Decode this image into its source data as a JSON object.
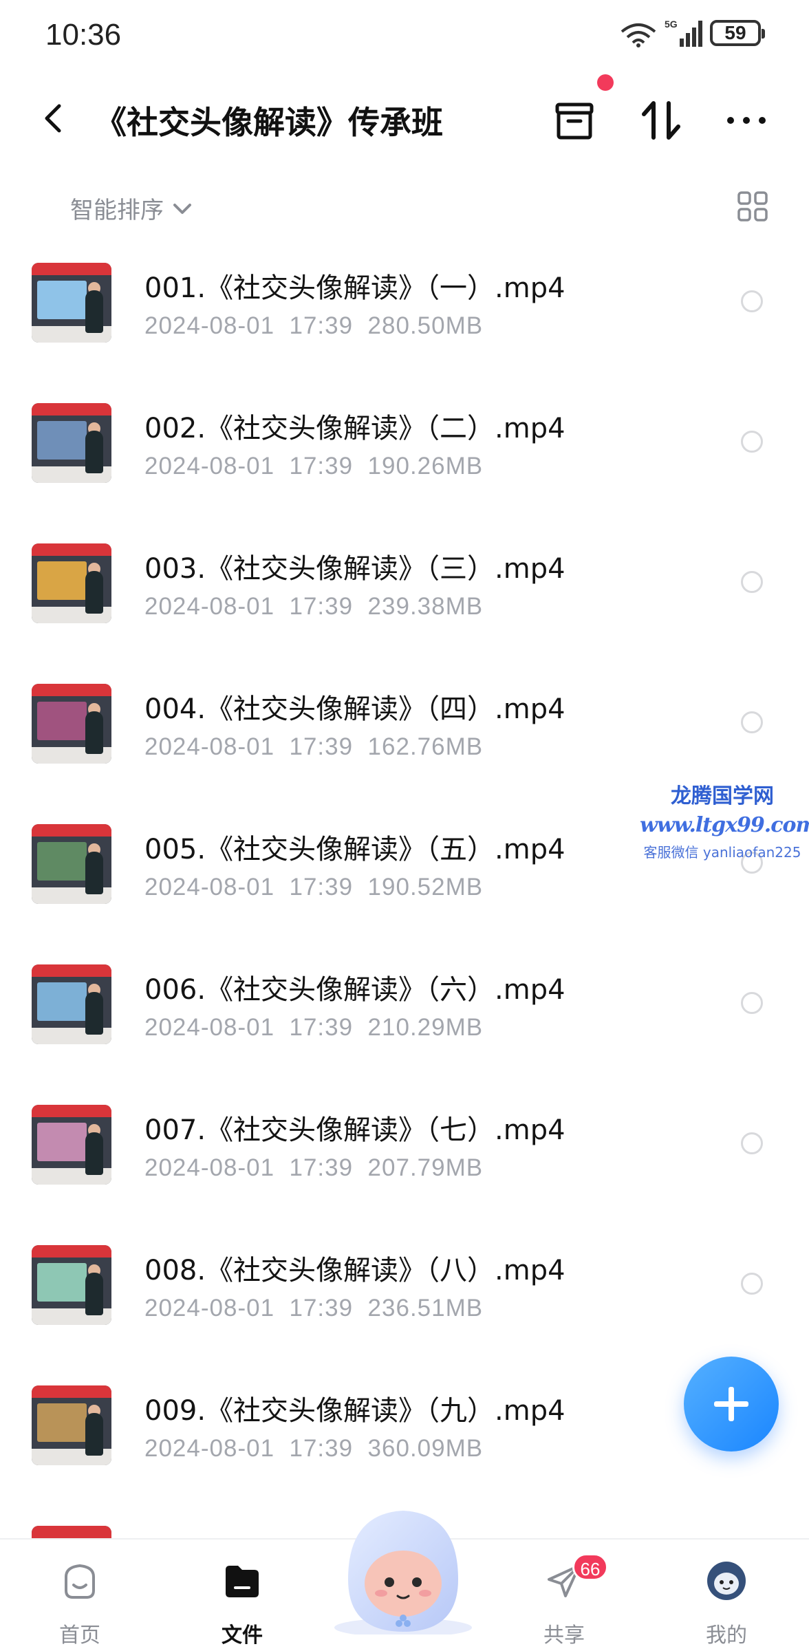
{
  "status_bar": {
    "time": "10:36",
    "network": "5G",
    "battery": "59"
  },
  "header": {
    "title": "《社交头像解读》传承班"
  },
  "sort": {
    "label": "智能排序"
  },
  "files": [
    {
      "name": "001.《社交头像解读》（一）.mp4",
      "date": "2024-08-01",
      "time": "17:39",
      "size": "280.50MB"
    },
    {
      "name": "002.《社交头像解读》（二）.mp4",
      "date": "2024-08-01",
      "time": "17:39",
      "size": "190.26MB"
    },
    {
      "name": "003.《社交头像解读》（三）.mp4",
      "date": "2024-08-01",
      "time": "17:39",
      "size": "239.38MB"
    },
    {
      "name": "004.《社交头像解读》（四）.mp4",
      "date": "2024-08-01",
      "time": "17:39",
      "size": "162.76MB"
    },
    {
      "name": "005.《社交头像解读》（五）.mp4",
      "date": "2024-08-01",
      "time": "17:39",
      "size": "190.52MB"
    },
    {
      "name": "006.《社交头像解读》（六）.mp4",
      "date": "2024-08-01",
      "time": "17:39",
      "size": "210.29MB"
    },
    {
      "name": "007.《社交头像解读》（七）.mp4",
      "date": "2024-08-01",
      "time": "17:39",
      "size": "207.79MB"
    },
    {
      "name": "008.《社交头像解读》（八）.mp4",
      "date": "2024-08-01",
      "time": "17:39",
      "size": "236.51MB"
    },
    {
      "name": "009.《社交头像解读》（九）.mp4",
      "date": "2024-08-01",
      "time": "17:39",
      "size": "360.09MB"
    }
  ],
  "watermark": {
    "title": "龙腾国学网",
    "url": "www.ltgx99.com",
    "contact": "客服微信 yanliaofan225"
  },
  "bottom_nav": [
    {
      "label": "首页",
      "icon": "home-face-icon"
    },
    {
      "label": "文件",
      "icon": "folder-icon",
      "active": true
    },
    {
      "label": "共享",
      "icon": "send-icon",
      "badge": "66"
    },
    {
      "label": "我的",
      "icon": "avatar-icon"
    }
  ],
  "colors": {
    "accent": "#1a86ff",
    "badge": "#f23a5b",
    "meta_text": "#a3a6ad",
    "watermark": "#2f5fd1"
  }
}
